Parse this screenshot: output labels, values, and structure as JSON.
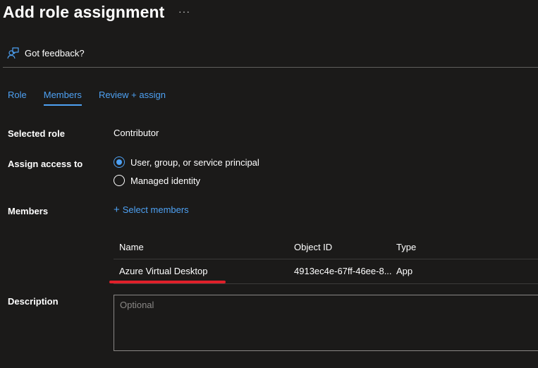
{
  "header": {
    "title": "Add role assignment",
    "more_label": "···"
  },
  "feedback": {
    "label": "Got feedback?",
    "icon": "feedback-person-icon"
  },
  "tabs": [
    {
      "label": "Role",
      "active": false
    },
    {
      "label": "Members",
      "active": true
    },
    {
      "label": "Review + assign",
      "active": false
    }
  ],
  "form": {
    "selected_role": {
      "label": "Selected role",
      "value": "Contributor"
    },
    "assign_access": {
      "label": "Assign access to",
      "options": [
        {
          "label": "User, group, or service principal",
          "checked": true
        },
        {
          "label": "Managed identity",
          "checked": false
        }
      ]
    },
    "members": {
      "label": "Members",
      "select_label": "Select members",
      "columns": [
        "Name",
        "Object ID",
        "Type"
      ],
      "rows": [
        {
          "name": "Azure Virtual Desktop",
          "object_id": "4913ec4e-67ff-46ee-8...",
          "type": "App"
        }
      ]
    },
    "description": {
      "label": "Description",
      "placeholder": "Optional",
      "value": ""
    }
  },
  "colors": {
    "background": "#1b1a19",
    "accent": "#4ea1f3",
    "highlight": "#e0202a"
  }
}
